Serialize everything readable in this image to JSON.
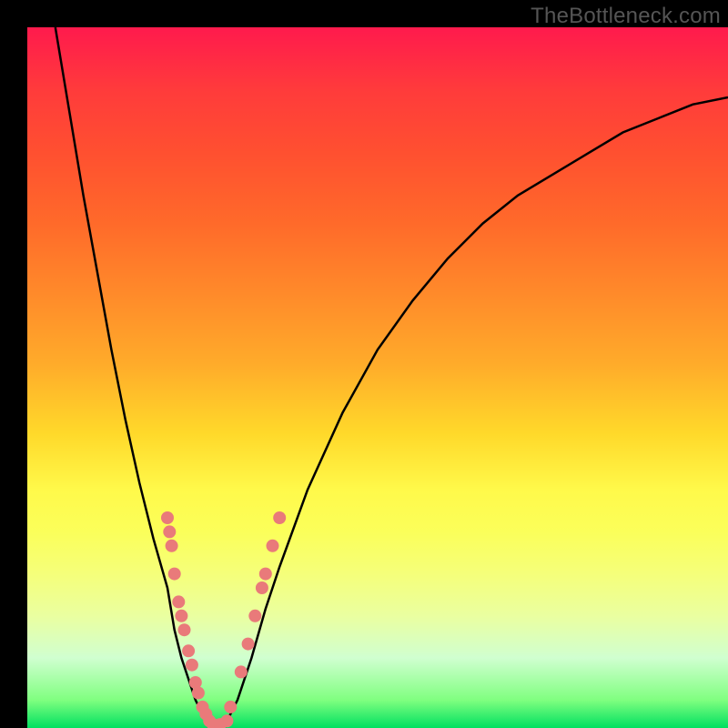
{
  "watermark": "TheBottleneck.com",
  "colors": {
    "frame": "#000000",
    "curve": "#000000",
    "dot": "#e97a7a",
    "gradient_top": "#ff1a4d",
    "gradient_bottom": "#00e060"
  },
  "chart_data": {
    "type": "line",
    "title": "",
    "xlabel": "",
    "ylabel": "",
    "xlim": [
      0,
      100
    ],
    "ylim": [
      0,
      100
    ],
    "series": [
      {
        "name": "left_curve",
        "x": [
          4,
          6,
          8,
          10,
          12,
          14,
          16,
          18,
          20,
          21,
          22,
          23,
          24,
          25,
          26
        ],
        "values": [
          100,
          88,
          76,
          65,
          54,
          44,
          35,
          27,
          20,
          14,
          10,
          7,
          4,
          2,
          0
        ]
      },
      {
        "name": "right_curve",
        "x": [
          28,
          30,
          32,
          34,
          36,
          40,
          45,
          50,
          55,
          60,
          65,
          70,
          75,
          80,
          85,
          90,
          95,
          100
        ],
        "values": [
          0,
          4,
          10,
          17,
          23,
          34,
          45,
          54,
          61,
          67,
          72,
          76,
          79,
          82,
          85,
          87,
          89,
          90
        ]
      }
    ],
    "highlight_points": [
      {
        "x": 20.0,
        "y": 30.0
      },
      {
        "x": 20.3,
        "y": 28.0
      },
      {
        "x": 20.6,
        "y": 26.0
      },
      {
        "x": 21.0,
        "y": 22.0
      },
      {
        "x": 21.6,
        "y": 18.0
      },
      {
        "x": 22.0,
        "y": 16.0
      },
      {
        "x": 22.4,
        "y": 14.0
      },
      {
        "x": 23.0,
        "y": 11.0
      },
      {
        "x": 23.5,
        "y": 9.0
      },
      {
        "x": 24.0,
        "y": 6.5
      },
      {
        "x": 24.4,
        "y": 5.0
      },
      {
        "x": 25.0,
        "y": 3.0
      },
      {
        "x": 25.5,
        "y": 2.0
      },
      {
        "x": 26.0,
        "y": 1.0
      },
      {
        "x": 26.5,
        "y": 0.5
      },
      {
        "x": 27.5,
        "y": 0.5
      },
      {
        "x": 28.5,
        "y": 1.0
      },
      {
        "x": 29.0,
        "y": 3.0
      },
      {
        "x": 30.5,
        "y": 8.0
      },
      {
        "x": 31.5,
        "y": 12.0
      },
      {
        "x": 32.5,
        "y": 16.0
      },
      {
        "x": 33.5,
        "y": 20.0
      },
      {
        "x": 34.0,
        "y": 22.0
      },
      {
        "x": 35.0,
        "y": 26.0
      },
      {
        "x": 36.0,
        "y": 30.0
      }
    ]
  }
}
